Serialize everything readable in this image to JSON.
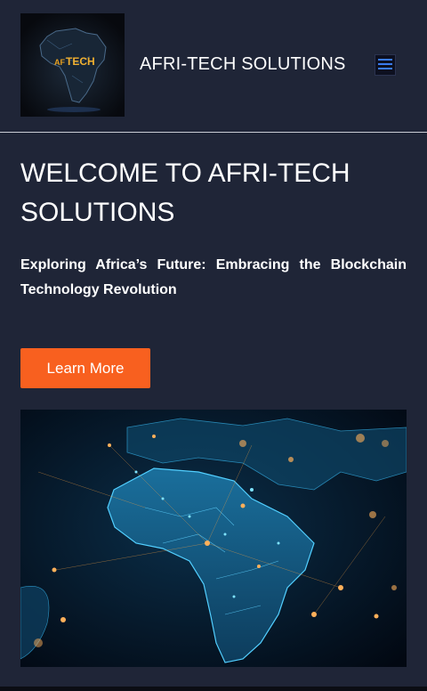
{
  "header": {
    "logo_text": "TECH",
    "logo_prefix": "AF",
    "title": "AFRI-TECH SOLUTIONS",
    "menu_icon": "hamburger-menu-icon"
  },
  "hero": {
    "title": "WELCOME TO AFRI-TECH SOLUTIONS",
    "subtitle": "Exploring Africa’s Future: Embracing the Blockchain Technology Revolution",
    "cta_label": "Learn More",
    "image": "africa-network-map"
  },
  "colors": {
    "background": "#1f2537",
    "accent": "#f8601f",
    "menu_icon": "#3a7bf0"
  }
}
